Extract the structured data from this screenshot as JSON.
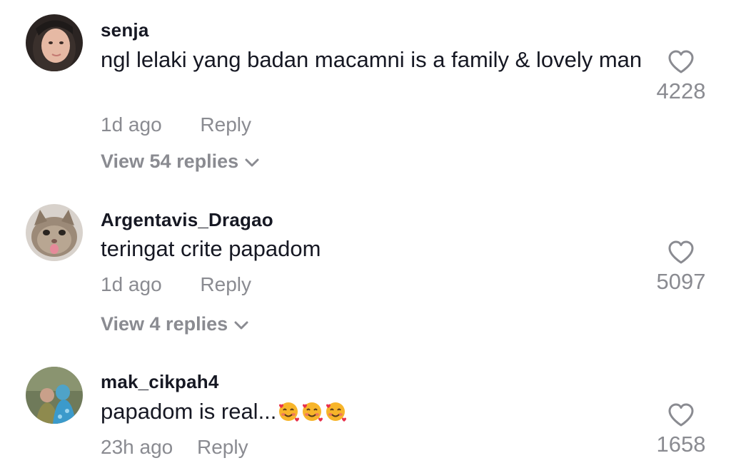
{
  "comments": [
    {
      "username": "senja",
      "text": "ngl lelaki yang badan macamni is a family & lovely man",
      "time": "1d ago",
      "reply_label": "Reply",
      "likes": "4228",
      "view_replies": "View 54 replies",
      "avatar": "avatar-girl-hijab"
    },
    {
      "username": "Argentavis_Dragao",
      "text": "teringat crite papadom",
      "time": "1d ago",
      "reply_label": "Reply",
      "likes": "5097",
      "view_replies": "View 4 replies",
      "avatar": "avatar-cat"
    },
    {
      "username": "mak_cikpah4",
      "text": "papadom is real...",
      "emoji": "smiling-face-with-hearts",
      "emoji_count": 3,
      "time": "23h ago",
      "reply_label": "Reply",
      "likes": "1658",
      "avatar": "avatar-couple"
    }
  ],
  "colors": {
    "primary_text": "#161823",
    "secondary_text": "#8a8b91",
    "background": "#ffffff"
  },
  "icons": {
    "like": "heart-outline-icon",
    "expand": "chevron-down-icon"
  }
}
